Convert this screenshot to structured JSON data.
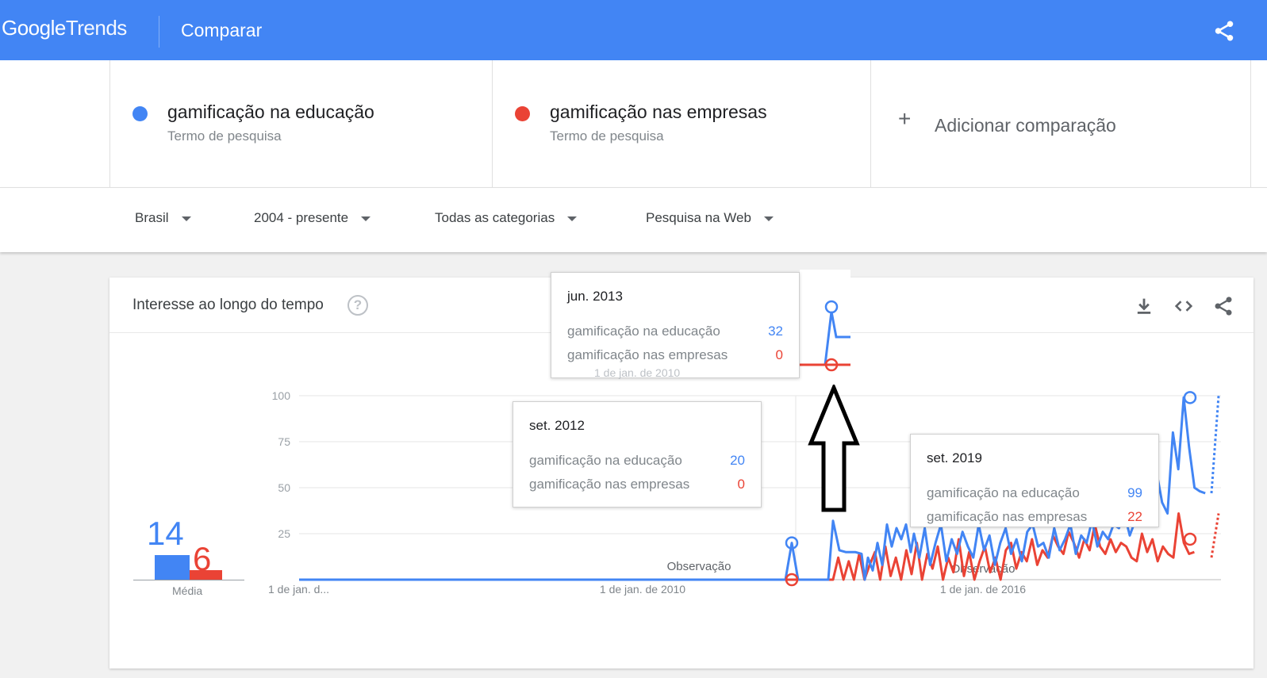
{
  "header": {
    "logo_google": "Google",
    "logo_trends": "Trends",
    "title": "Comparar",
    "share_icon": "share-icon"
  },
  "terms": [
    {
      "name": "gamificação na educação",
      "sub": "Termo de pesquisa",
      "color": "#4285f4"
    },
    {
      "name": "gamificação nas empresas",
      "sub": "Termo de pesquisa",
      "color": "#ea4335"
    }
  ],
  "add_comparison": {
    "plus": "+",
    "label": "Adicionar comparação"
  },
  "filters": {
    "region": "Brasil",
    "period": "2004 - presente",
    "category": "Todas as categorias",
    "search_type": "Pesquisa na Web"
  },
  "card": {
    "title": "Interesse ao longo do tempo",
    "help": "?",
    "icons": [
      "download-icon",
      "embed-icon",
      "share-icon"
    ]
  },
  "averages": {
    "label": "Média",
    "values": [
      {
        "value": "14",
        "color": "#4285f4"
      },
      {
        "value": "6",
        "color": "#ea4335"
      }
    ]
  },
  "chart_data": {
    "type": "line",
    "y_ticks": [
      "100",
      "75",
      "50",
      "25"
    ],
    "ylim": [
      0,
      100
    ],
    "x_ticks": [
      "1 de jan. d...",
      "1 de jan. de 2010",
      "1 de jan. de 2016"
    ],
    "annotations": [
      "Observação",
      "Observação"
    ],
    "x": [
      "2004-01",
      "2012-09",
      "2013-06",
      "2013-07",
      "2014-01",
      "2015-01",
      "2016-01",
      "2017-01",
      "2018-01",
      "2019-01",
      "2019-09",
      "2020-01"
    ],
    "series": [
      {
        "name": "gamificação na educação",
        "color": "#4285f4",
        "values": [
          0,
          20,
          32,
          16,
          12,
          30,
          20,
          25,
          30,
          45,
          99,
          47
        ]
      },
      {
        "name": "gamificação nas empresas",
        "color": "#ea4335",
        "values": [
          0,
          0,
          0,
          0,
          5,
          15,
          10,
          15,
          20,
          25,
          22,
          15
        ]
      }
    ],
    "grid": true
  },
  "tooltips": [
    {
      "date": "jun. 2013",
      "rows": [
        {
          "label": "gamificação na educação",
          "value": "32",
          "color": "#4285f4"
        },
        {
          "label": "gamificação nas empresas",
          "value": "0",
          "color": "#ea4335"
        }
      ],
      "overlay_label": "1 de jan. de 2010"
    },
    {
      "date": "set. 2012",
      "rows": [
        {
          "label": "gamificação na educação",
          "value": "20",
          "color": "#4285f4"
        },
        {
          "label": "gamificação nas empresas",
          "value": "0",
          "color": "#ea4335"
        }
      ]
    },
    {
      "date": "set. 2019",
      "rows": [
        {
          "label": "gamificação na educação",
          "value": "99",
          "color": "#4285f4"
        },
        {
          "label": "gamificação nas empresas",
          "value": "22",
          "color": "#ea4335"
        }
      ]
    }
  ]
}
